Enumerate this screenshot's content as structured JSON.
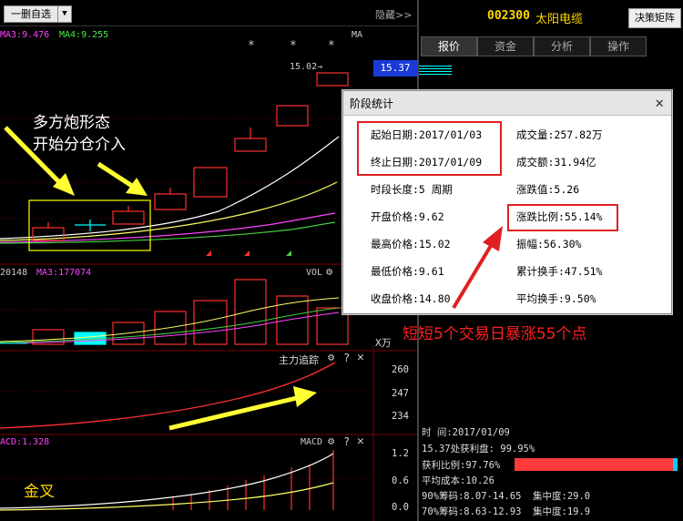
{
  "topbar": {
    "stock_select": "一删自选",
    "hide_label": "隐藏>>"
  },
  "stock": {
    "code": "002300",
    "name": "太阳电缆",
    "decision_button": "决策矩阵"
  },
  "tabs": [
    "报价",
    "资金",
    "分析",
    "操作"
  ],
  "main_chart": {
    "ma3": "MA3:9.476",
    "ma4": "MA4:9.255",
    "ma_title": "MA",
    "peak_price": "15.02→",
    "current_price": "15.37"
  },
  "volume_panel": {
    "label_left": "20148",
    "ma3": "MA3:177074",
    "title": "VOL",
    "unit": "X万"
  },
  "main_force_panel": {
    "title": "主力追踪",
    "y_labels": [
      "260",
      "247",
      "234"
    ]
  },
  "macd_panel": {
    "label": "ACD:1.328",
    "title": "MACD",
    "y_labels": [
      "1.2",
      "0.6",
      "0.0"
    ]
  },
  "dialog": {
    "title": "阶段统计",
    "start_date": "起始日期:2017/01/03",
    "end_date": "终止日期:2017/01/09",
    "period": "时段长度:5 周期",
    "open": "开盘价格:9.62",
    "high": "最高价格:15.02",
    "low": "最低价格:9.61",
    "close": "收盘价格:14.80",
    "volume": "成交量:257.82万",
    "amount": "成交额:31.94亿",
    "change_value": "涨跌值:5.26",
    "change_ratio": "涨跌比例:55.14%",
    "amplitude": "振幅:56.30%",
    "cum_turnover": "累计换手:47.51%",
    "avg_turnover": "平均换手:9.50%"
  },
  "annotations": {
    "pattern_line1": "多方炮形态",
    "pattern_line2": "开始分仓介入",
    "surge": "短短5个交易日暴涨55个点",
    "golden_cross": "金叉"
  },
  "chip_info": {
    "time": "时      间:2017/01/09",
    "profit_plate": "15.37处获利盘: 99.95%",
    "profit_ratio": "获利比例:97.76%",
    "avg_cost": "平均成本:10.26",
    "chip90": "90%筹码:8.07-14.65",
    "conc90": "集中度:29.0",
    "chip70": "70%筹码:8.63-12.93",
    "conc70": "集中度:19.9"
  },
  "colors": {
    "up": "#ff3030",
    "accent_yellow": "#ffd700",
    "ma_white": "#ffffff",
    "ma_yellow": "#ffff66",
    "ma_magenta": "#ff44ff",
    "ma_green": "#44cc44"
  }
}
